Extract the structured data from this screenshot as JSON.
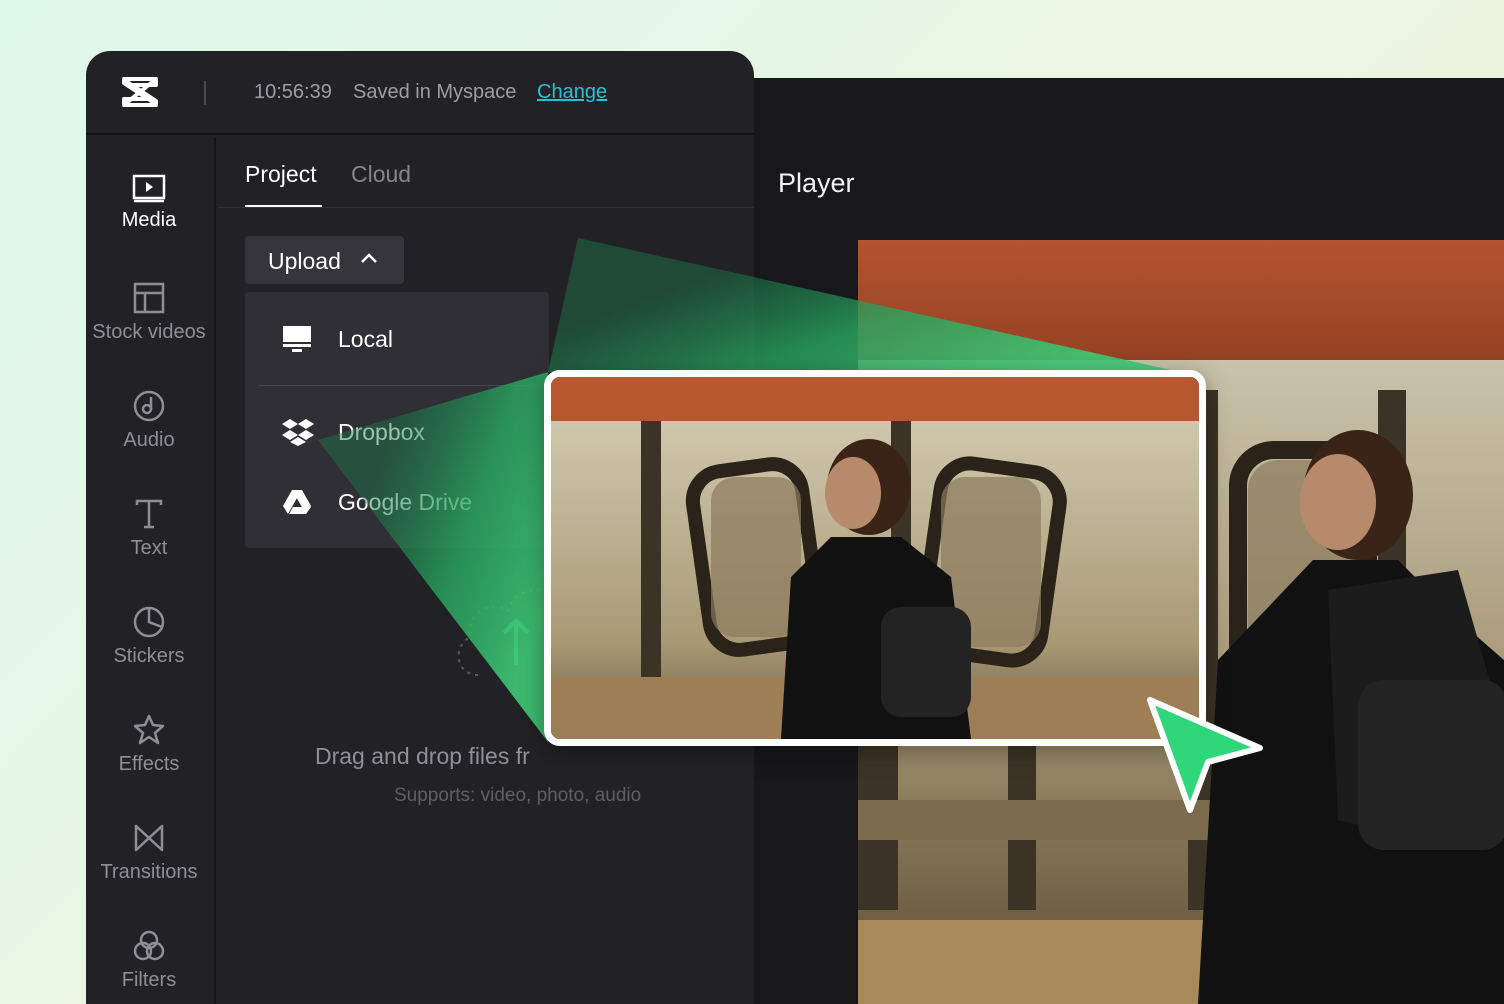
{
  "header": {
    "save_time": "10:56:39",
    "save_status": "Saved in Myspace",
    "change_link": "Change"
  },
  "sidebar": {
    "items": [
      {
        "label": "Media",
        "icon": "media-icon",
        "active": true
      },
      {
        "label": "Stock videos",
        "icon": "stock-videos-icon"
      },
      {
        "label": "Audio",
        "icon": "audio-icon"
      },
      {
        "label": "Text",
        "icon": "text-icon"
      },
      {
        "label": "Stickers",
        "icon": "stickers-icon"
      },
      {
        "label": "Effects",
        "icon": "effects-icon"
      },
      {
        "label": "Transitions",
        "icon": "transitions-icon"
      },
      {
        "label": "Filters",
        "icon": "filters-icon"
      }
    ]
  },
  "tabs": {
    "project": "Project",
    "cloud": "Cloud",
    "active": "Project"
  },
  "upload": {
    "label": "Upload",
    "menu": [
      {
        "label": "Local",
        "icon": "monitor-icon"
      },
      {
        "label": "Dropbox",
        "icon": "dropbox-icon"
      },
      {
        "label": "Google Drive",
        "icon": "google-drive-icon"
      }
    ]
  },
  "dropzone": {
    "title": "Drag and drop files fr",
    "subtitle": "Supports: video, photo, audio"
  },
  "player": {
    "title": "Player"
  },
  "colors": {
    "accent": "#1fc5d6",
    "highlight_green": "#2fd67a",
    "panel_bg": "#222226",
    "player_bg": "#18181b"
  }
}
